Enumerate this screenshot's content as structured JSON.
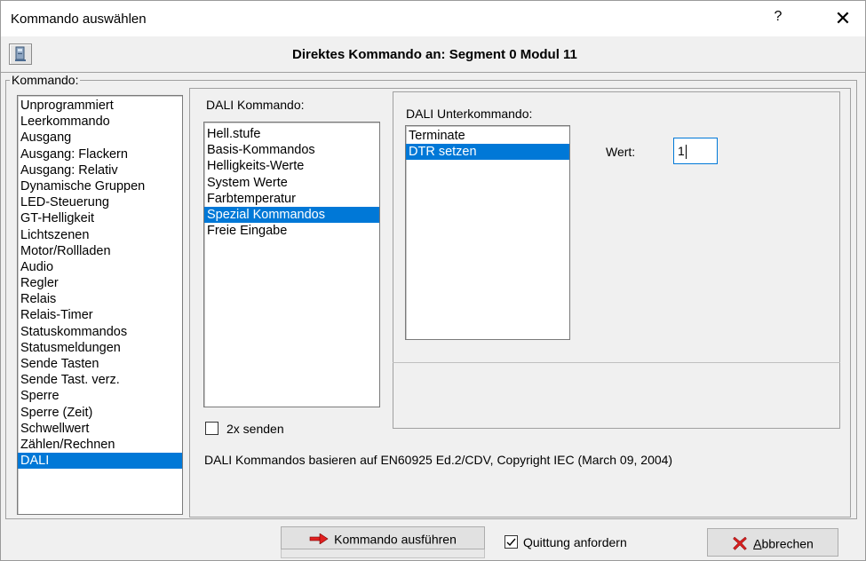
{
  "window": {
    "title": "Kommando auswählen",
    "help_label": "?",
    "close_label": "✕"
  },
  "header": {
    "title": "Direktes Kommando an: Segment 0 Modul 11"
  },
  "group": {
    "label": "Kommando:"
  },
  "command_list": {
    "items": [
      "Unprogrammiert",
      "Leerkommando",
      "Ausgang",
      "Ausgang: Flackern",
      "Ausgang: Relativ",
      "Dynamische Gruppen",
      "LED-Steuerung",
      "GT-Helligkeit",
      "Lichtszenen",
      "Motor/Rollladen",
      "Audio",
      "Regler",
      "Relais",
      "Relais-Timer",
      "Statuskommandos",
      "Statusmeldungen",
      "Sende Tasten",
      "Sende Tast. verz.",
      "Sperre",
      "Sperre (Zeit)",
      "Schwellwert",
      "Zählen/Rechnen",
      "DALI"
    ],
    "selected": "DALI"
  },
  "dali": {
    "label": "DALI Kommando:",
    "items": [
      "Hell.stufe",
      "Basis-Kommandos",
      "Helligkeits-Werte",
      "System Werte",
      "Farbtemperatur",
      "Spezial Kommandos",
      "Freie Eingabe"
    ],
    "selected": "Spezial Kommandos",
    "sub_label": "DALI Unterkommando:",
    "sub_items": [
      "Terminate",
      "DTR setzen"
    ],
    "sub_selected": "DTR setzen",
    "value_label": "Wert:",
    "value": "1",
    "send_twice_label": "2x senden",
    "send_twice_checked": false,
    "copyright": "DALI Kommandos basieren auf EN60925 Ed.2/CDV, Copyright IEC (March 09, 2004)"
  },
  "footer": {
    "execute_label": "Kommando ausführen",
    "ack_label": "Quittung anfordern",
    "ack_checked": true,
    "cancel_rest": "bbrechen",
    "cancel_accel": "A"
  },
  "colors": {
    "selection": "#0078d7",
    "cancel_icon": "#d42020",
    "execute_icon": "#e02020"
  }
}
